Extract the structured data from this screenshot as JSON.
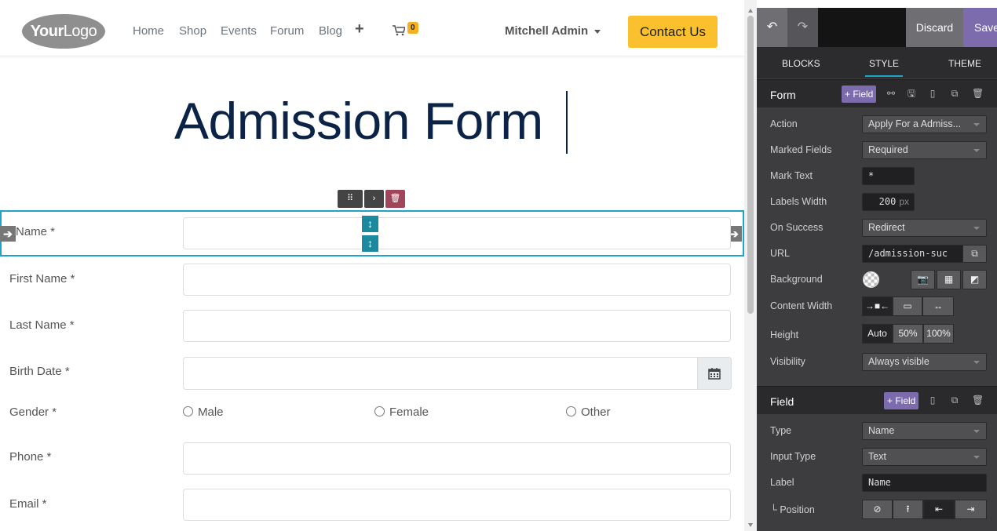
{
  "site": {
    "logo": {
      "bold": "Your",
      "light": "Logo"
    },
    "nav": [
      "Home",
      "Shop",
      "Events",
      "Forum",
      "Blog"
    ],
    "cart_count": "0",
    "user": "Mitchell Admin",
    "contact": "Contact Us",
    "title": "Admission Form",
    "fields": [
      {
        "label": "Name *"
      },
      {
        "label": "First Name *"
      },
      {
        "label": "Last Name *"
      },
      {
        "label": "Birth Date *"
      },
      {
        "label": "Gender *"
      },
      {
        "label": "Phone *"
      },
      {
        "label": "Email *"
      }
    ],
    "gender_options": [
      "Male",
      "Female",
      "Other"
    ],
    "colors": {
      "primary": "#0b2346",
      "accent": "#fbc02d",
      "selection": "#1fa4c8"
    }
  },
  "editor": {
    "undo": "↶",
    "redo": "↷",
    "discard": "Discard",
    "save": "Save",
    "tabs": [
      "BLOCKS",
      "STYLE",
      "THEME"
    ],
    "form": {
      "title": "Form",
      "add_field": "+ Field",
      "action_label": "Action",
      "action_value": "Apply For a Admiss...",
      "marked_label": "Marked Fields",
      "marked_value": "Required",
      "marktext_label": "Mark Text",
      "marktext_value": "*",
      "labelwidth_label": "Labels Width",
      "labelwidth_value": "200",
      "labelwidth_unit": "px",
      "onsuccess_label": "On Success",
      "onsuccess_value": "Redirect",
      "url_label": "URL",
      "url_value": "/admission-suc",
      "background_label": "Background",
      "contentwidth_label": "Content Width",
      "height_label": "Height",
      "height_options": [
        "Auto",
        "50%",
        "100%"
      ],
      "visibility_label": "Visibility",
      "visibility_value": "Always visible"
    },
    "field": {
      "title": "Field",
      "add_field": "+ Field",
      "type_label": "Type",
      "type_value": "Name",
      "inputtype_label": "Input Type",
      "inputtype_value": "Text",
      "label_label": "Label",
      "label_value": "Name",
      "position_label": "└ Position"
    },
    "colors": {
      "panel": "#3d3d3f",
      "purple": "#7c6cae",
      "tab_underline": "#1ea4c8"
    }
  }
}
